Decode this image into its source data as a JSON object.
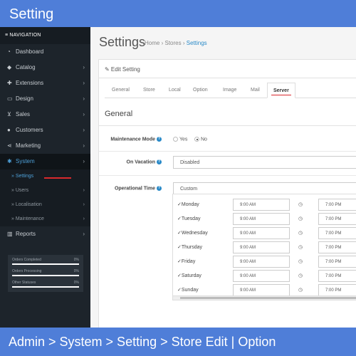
{
  "banner": {
    "title": "Setting",
    "caption": "Admin > System > Setting > Store Edit | Option"
  },
  "sidebar": {
    "header": "≡ NAVIGATION",
    "items": [
      {
        "label": "Dashboard",
        "icon": "dashboard-icon",
        "glyph": "◔"
      },
      {
        "label": "Catalog",
        "icon": "tag-icon",
        "glyph": "◆"
      },
      {
        "label": "Extensions",
        "icon": "puzzle-icon",
        "glyph": "✚"
      },
      {
        "label": "Design",
        "icon": "monitor-icon",
        "glyph": "▭"
      },
      {
        "label": "Sales",
        "icon": "cart-icon",
        "glyph": "⊻"
      },
      {
        "label": "Customers",
        "icon": "user-icon",
        "glyph": "●"
      },
      {
        "label": "Marketing",
        "icon": "share-icon",
        "glyph": "⋖"
      },
      {
        "label": "System",
        "icon": "gear-icon",
        "glyph": "✱"
      }
    ],
    "subitems": [
      {
        "label": "Settings"
      },
      {
        "label": "Users"
      },
      {
        "label": "Localisation"
      },
      {
        "label": "Maintenance"
      }
    ],
    "reports": {
      "label": "Reports",
      "icon": "bar-chart-icon",
      "glyph": "▥"
    },
    "stats": [
      {
        "label": "Orders Completed",
        "value": "0%"
      },
      {
        "label": "Orders Processing",
        "value": "0%"
      },
      {
        "label": "Other Statuses",
        "value": "0%"
      }
    ]
  },
  "header": {
    "title": "Settings",
    "breadcrumb": [
      "Home",
      "Stores",
      "Settings"
    ],
    "separator": "›"
  },
  "panel": {
    "heading": "✎ Edit Setting",
    "tabs": [
      "General",
      "Store",
      "Local",
      "Option",
      "Image",
      "Mail",
      "Server"
    ],
    "active_tab": "Server",
    "section_title": "General",
    "maintenance": {
      "label": "Maintenance Mode",
      "options": [
        "Yes",
        "No"
      ],
      "selected": "No"
    },
    "vacation": {
      "label": "On Vacation",
      "value": "Disabled"
    },
    "operational": {
      "label": "Operational Time",
      "value": "Custom",
      "days": [
        {
          "day": "Monday",
          "open": "9:00 AM",
          "close": "7:00 PM"
        },
        {
          "day": "Tuesday",
          "open": "9:00 AM",
          "close": "7:00 PM"
        },
        {
          "day": "Wednesday",
          "open": "9:00 AM",
          "close": "7:00 PM"
        },
        {
          "day": "Thursday",
          "open": "9:00 AM",
          "close": "7:00 PM"
        },
        {
          "day": "Friday",
          "open": "9:00 AM",
          "close": "7:00 PM"
        },
        {
          "day": "Saturday",
          "open": "9:00 AM",
          "close": "7:00 PM"
        },
        {
          "day": "Sunday",
          "open": "9:00 AM",
          "close": "7:00 PM"
        }
      ]
    }
  },
  "colors": {
    "banner": "#4f7ed8",
    "sidebar": "#1d242b",
    "accent": "#2a8ac8",
    "highlight": "#d9292d"
  }
}
